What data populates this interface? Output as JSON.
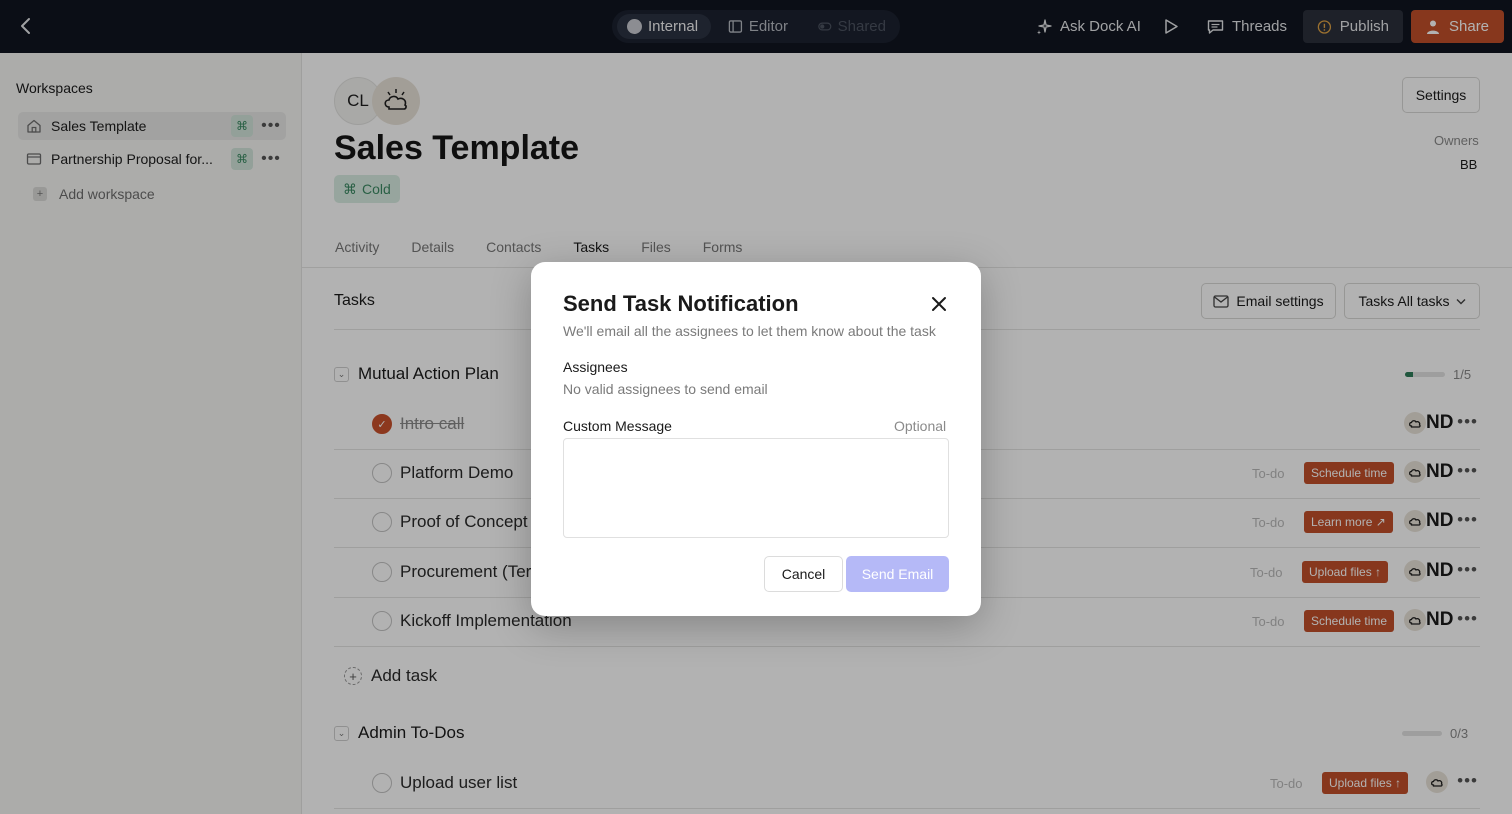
{
  "topbar": {
    "modes": [
      {
        "label": "Internal",
        "state": "active"
      },
      {
        "label": "Editor",
        "state": "normal"
      },
      {
        "label": "Shared",
        "state": "disabled"
      }
    ],
    "ask_ai": "Ask Dock AI",
    "threads": "Threads",
    "publish": "Publish",
    "share": "Share"
  },
  "sidebar": {
    "title": "Workspaces",
    "items": [
      {
        "label": "Sales Template",
        "icon": "home-icon",
        "active": true
      },
      {
        "label": "Partnership Proposal for...",
        "icon": "window-icon",
        "active": false
      }
    ],
    "add_label": "Add workspace"
  },
  "header": {
    "avatar_initials": "CL",
    "title": "Sales Template",
    "badge": "Cold",
    "settings": "Settings",
    "owners_label": "Owners",
    "owners_value": "BB"
  },
  "tabs": [
    "Activity",
    "Details",
    "Contacts",
    "Tasks",
    "Files",
    "Forms"
  ],
  "active_tab": "Tasks",
  "tasks_section": {
    "title": "Tasks",
    "email_settings": "Email settings",
    "filter": "Tasks All tasks"
  },
  "groups": [
    {
      "name": "Mutual Action Plan",
      "progress": "1/5",
      "progress_fraction": 0.2,
      "tasks": [
        {
          "name": "Intro call",
          "done": true,
          "status": "",
          "action": "",
          "assignee": "ND"
        },
        {
          "name": "Platform Demo",
          "done": false,
          "status": "To-do",
          "action": "Schedule time",
          "assignee": "ND"
        },
        {
          "name": "Proof of Concept",
          "done": false,
          "status": "To-do",
          "action": "Learn more ↗",
          "assignee": "ND"
        },
        {
          "name": "Procurement (Terr",
          "done": false,
          "status": "To-do",
          "action": "Upload files ↑",
          "assignee": "ND"
        },
        {
          "name": "Kickoff Implementation",
          "done": false,
          "status": "To-do",
          "action": "Schedule time",
          "assignee": "ND"
        }
      ],
      "add_task": "Add task"
    },
    {
      "name": "Admin To-Dos",
      "progress": "0/3",
      "progress_fraction": 0,
      "tasks": [
        {
          "name": "Upload user list",
          "done": false,
          "status": "To-do",
          "action": "Upload files ↑",
          "assignee": ""
        }
      ]
    }
  ],
  "modal": {
    "title": "Send Task Notification",
    "subtitle": "We'll email all the assignees to let them know about the task",
    "assignees_label": "Assignees",
    "assignees_info": "No valid assignees to send email",
    "message_label": "Custom Message",
    "message_optional": "Optional",
    "message_value": "",
    "cancel": "Cancel",
    "send": "Send Email"
  },
  "colors": {
    "topbar_bg": "#101520",
    "accent_orange": "#c2502a",
    "send_disabled": "#b5b9f7",
    "badge_green": "#3c8a64"
  }
}
